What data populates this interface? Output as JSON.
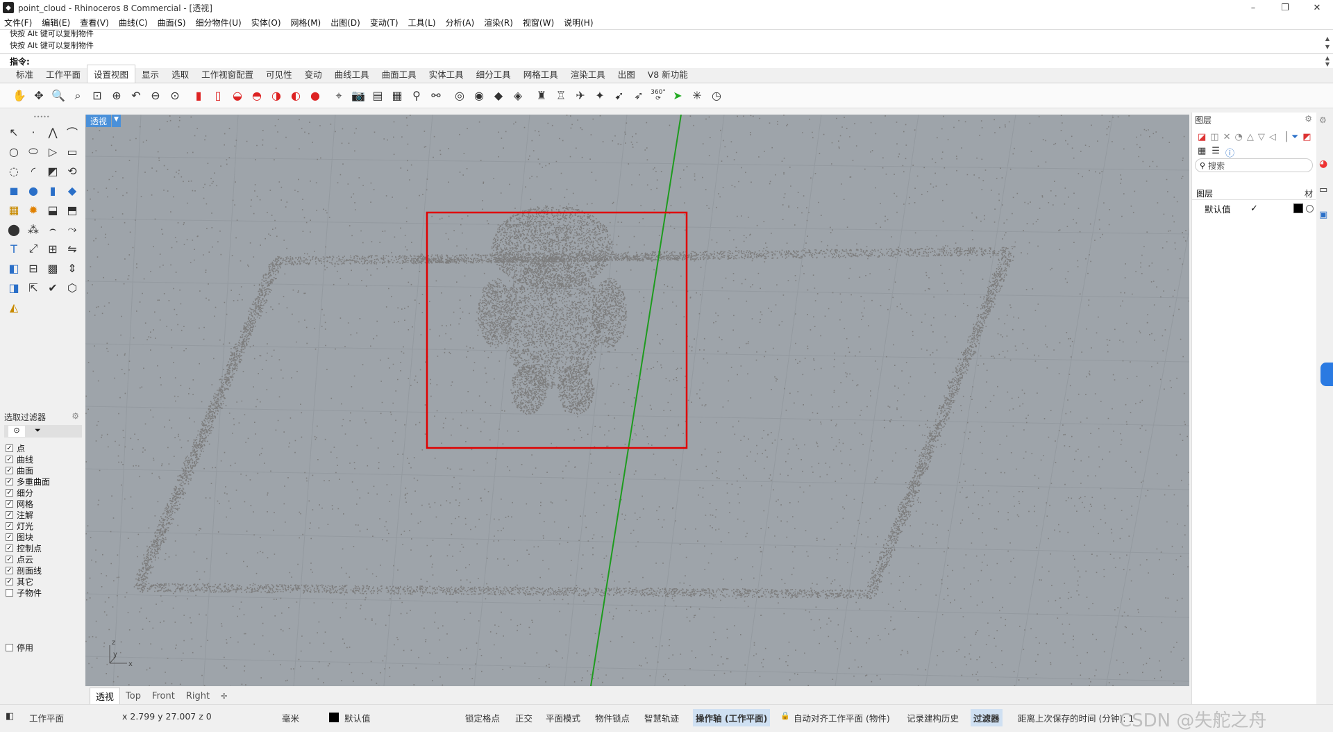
{
  "window": {
    "title": "point_cloud - Rhinoceros 8 Commercial - [透视]"
  },
  "menu": [
    "文件(F)",
    "编辑(E)",
    "查看(V)",
    "曲线(C)",
    "曲面(S)",
    "细分物件(U)",
    "实体(O)",
    "网格(M)",
    "出图(D)",
    "变动(T)",
    "工具(L)",
    "分析(A)",
    "渲染(R)",
    "视窗(W)",
    "说明(H)"
  ],
  "command": {
    "history": [
      "快按 Alt 键可以复制物件",
      "快按 Alt 键可以复制物件"
    ],
    "prompt": "指令:"
  },
  "toolbar_tabs": {
    "items": [
      "标准",
      "工作平面",
      "设置视图",
      "显示",
      "选取",
      "工作视窗配置",
      "可见性",
      "变动",
      "曲线工具",
      "曲面工具",
      "实体工具",
      "细分工具",
      "网格工具",
      "渲染工具",
      "出图",
      "V8 新功能"
    ],
    "active": "设置视图"
  },
  "toolbar_badge": "360°",
  "viewport": {
    "label": "透视",
    "axis_labels": {
      "z": "z",
      "y": "y",
      "x": "x"
    }
  },
  "selection_filter": {
    "title": "选取过滤器",
    "items": [
      {
        "label": "点",
        "checked": true
      },
      {
        "label": "曲线",
        "checked": true
      },
      {
        "label": "曲面",
        "checked": true
      },
      {
        "label": "多重曲面",
        "checked": true
      },
      {
        "label": "细分",
        "checked": true
      },
      {
        "label": "网格",
        "checked": true
      },
      {
        "label": "注解",
        "checked": true
      },
      {
        "label": "灯光",
        "checked": true
      },
      {
        "label": "图块",
        "checked": true
      },
      {
        "label": "控制点",
        "checked": true
      },
      {
        "label": "点云",
        "checked": true
      },
      {
        "label": "剖面线",
        "checked": true
      },
      {
        "label": "其它",
        "checked": true
      },
      {
        "label": "子物件",
        "checked": false
      }
    ],
    "disable": {
      "label": "停用",
      "checked": false
    }
  },
  "view_tabs": {
    "items": [
      "透视",
      "Top",
      "Front",
      "Right"
    ],
    "active": "透视",
    "add": "✢"
  },
  "layers": {
    "title": "图层",
    "search_placeholder": "搜索",
    "col_name": "图层",
    "col_material": "材",
    "rows": [
      {
        "name": "默认值",
        "current": "✓",
        "color": "#000000"
      }
    ]
  },
  "status": {
    "cplane": "工作平面",
    "coords": "x 2.799  y 27.007  z 0",
    "units": "毫米",
    "layer": "默认值",
    "toggles": [
      "锁定格点",
      "正交",
      "平面模式",
      "物件锁点",
      "智慧轨迹"
    ],
    "gumball": "操作轴 (工作平面)",
    "autoalign": "自动对齐工作平面 (物件)",
    "history": "记录建构历史",
    "filter": "过滤器",
    "save_time": "距离上次保存的时间 (分钟): 1"
  },
  "watermark": "CSDN @失舵之舟",
  "colors": {
    "viewport_bg": "#9ea4aa",
    "points": "#7d7d7d",
    "highlight": "#e00000",
    "axis_green": "#1e9b1e",
    "accent": "#4a90d9"
  }
}
